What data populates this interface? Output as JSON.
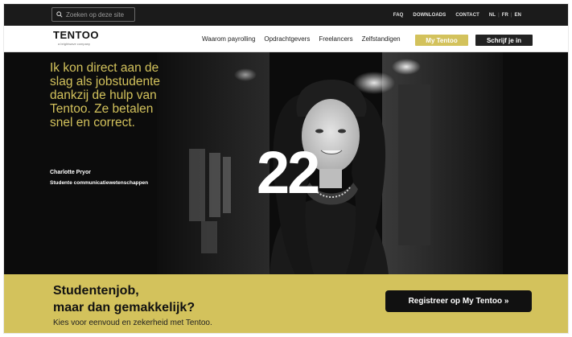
{
  "topbar": {
    "search_placeholder": "Zoeken op deze site",
    "links": [
      "FAQ",
      "DOWNLOADS",
      "CONTACT"
    ],
    "languages": [
      "NL",
      "FR",
      "EN"
    ]
  },
  "nav": {
    "logo": "TENTOO",
    "logo_tagline": "a brightwave company",
    "items": [
      "Waarom payrolling",
      "Opdrachtgevers",
      "Freelancers",
      "Zelfstandigen"
    ],
    "my_tentoo": "My Tentoo",
    "join": "Schrijf je in"
  },
  "hero": {
    "quote": "Ik kon direct aan de slag als jobstudente dankzij de hulp van Tentoo. Ze betalen snel en correct.",
    "person": "Charlotte Pryor",
    "role": "Studente communicatiewetenschappen",
    "counter": "22"
  },
  "cta": {
    "headline_line1": "Studentenjob,",
    "headline_line2": "maar dan gemakkelijk?",
    "subtext": "Kies voor eenvoud en zekerheid met Tentoo.",
    "button": "Registreer op My Tentoo »"
  },
  "colors": {
    "accent": "#d3c25c",
    "dark": "#1b1b1b"
  }
}
